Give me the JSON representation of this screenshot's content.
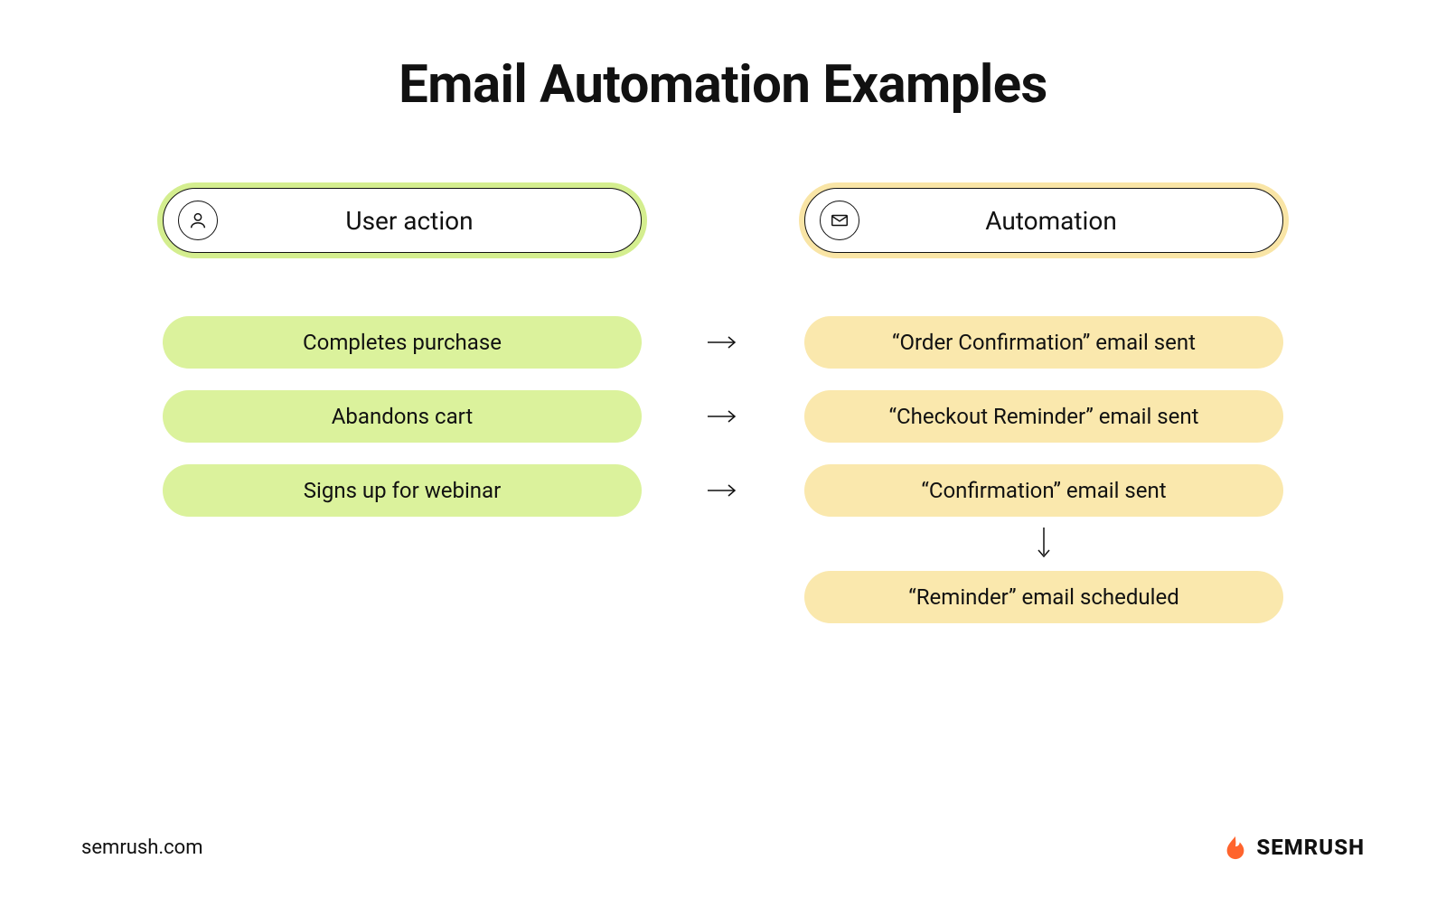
{
  "title": "Email Automation Examples",
  "columns": {
    "left": {
      "header": "User action",
      "items": [
        "Completes purchase",
        "Abandons cart",
        "Signs up for webinar"
      ]
    },
    "right": {
      "header": "Automation",
      "items": [
        "“Order Confirmation” email sent",
        "“Checkout Reminder” email sent",
        "“Confirmation” email sent",
        "“Reminder” email scheduled"
      ]
    }
  },
  "footer": {
    "domain": "semrush.com",
    "brand": "SEMRUSH"
  },
  "colors": {
    "green": "#dbf29c",
    "yellow": "#fae8ad",
    "brand_orange": "#ff642d"
  }
}
